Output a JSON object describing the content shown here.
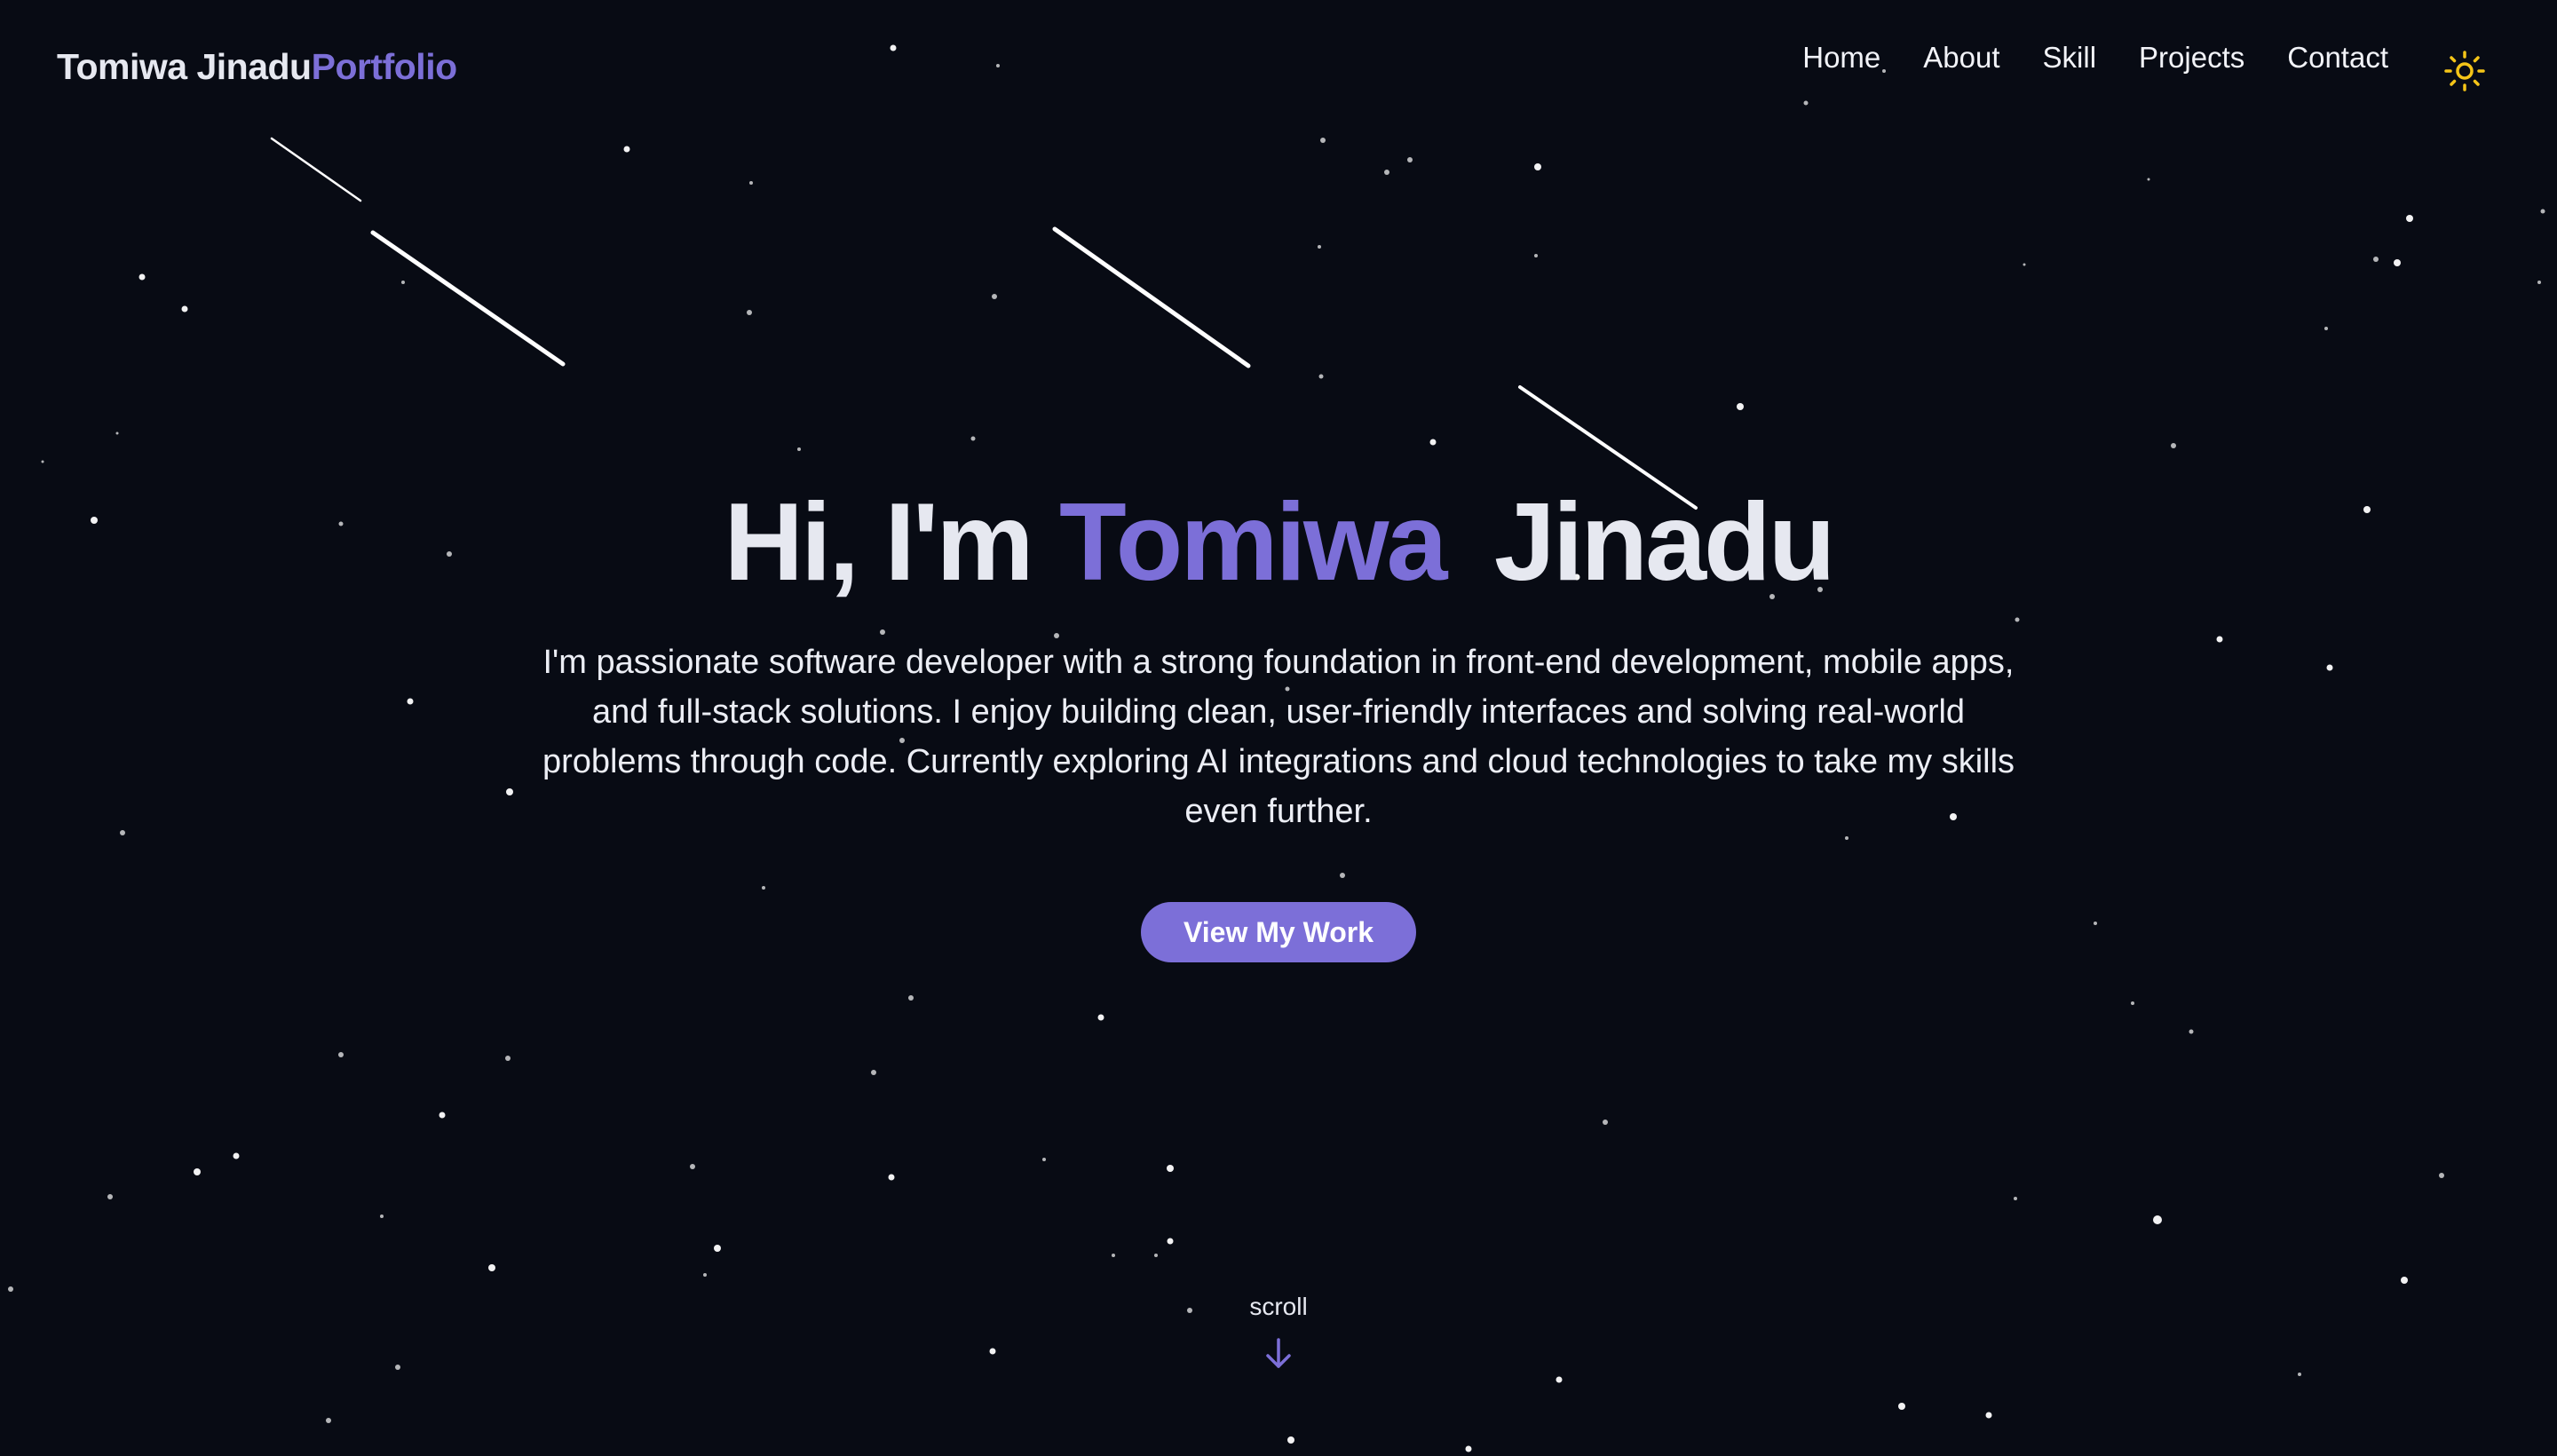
{
  "header": {
    "brand_name": "Tomiwa Jinadu",
    "brand_suffix": "Portfolio",
    "nav_items": [
      "Home",
      "About",
      "Skill",
      "Projects",
      "Contact"
    ],
    "theme_toggle_icon": "sun-icon"
  },
  "hero": {
    "greeting": "Hi, I'm",
    "first_name": "Tomiwa",
    "last_name": "Jinadu",
    "description": "I'm passionate software developer with a strong foundation in front-end development, mobile apps, and full-stack solutions. I enjoy building clean, user-friendly interfaces and solving real-world problems through code. Currently exploring AI integrations and cloud technologies to take my skills even further.",
    "cta_label": "View My Work"
  },
  "scroll": {
    "label": "scroll",
    "icon": "arrow-down-icon"
  },
  "colors": {
    "background": "#080b14",
    "accent": "#7c6fd8",
    "text": "#e6e8f0",
    "sun": "#f5c518"
  }
}
